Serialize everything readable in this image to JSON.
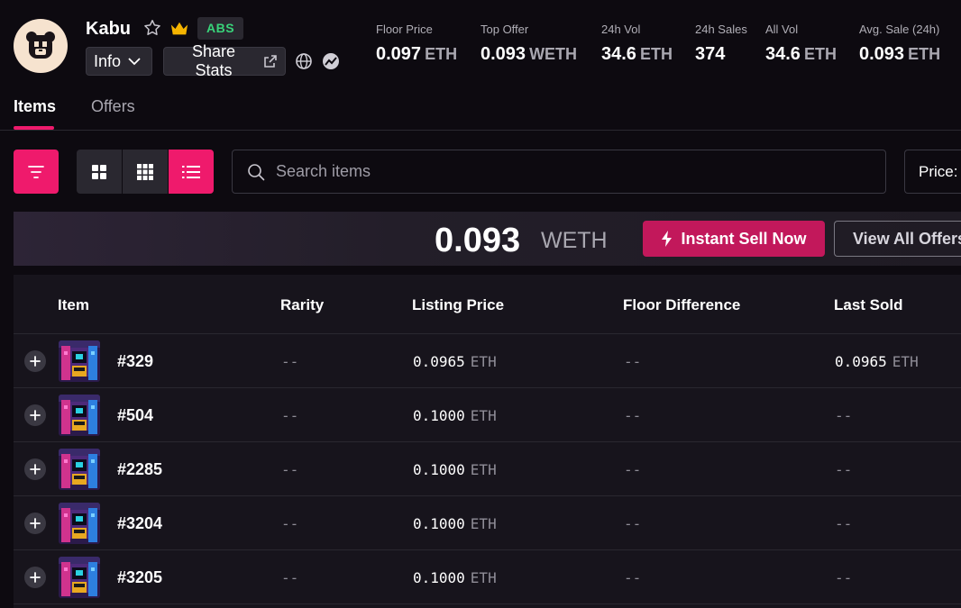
{
  "collection": {
    "name": "Kabu",
    "chain_badge": "ABS",
    "info_label": "Info",
    "share_label": "Share Stats"
  },
  "stats": [
    {
      "label": "Floor Price",
      "value": "0.097",
      "unit": "ETH"
    },
    {
      "label": "Top Offer",
      "value": "0.093",
      "unit": "WETH"
    },
    {
      "label": "24h Vol",
      "value": "34.6",
      "unit": "ETH"
    },
    {
      "label": "24h Sales",
      "value": "374",
      "unit": ""
    },
    {
      "label": "All Vol",
      "value": "34.6",
      "unit": "ETH"
    },
    {
      "label": "Avg. Sale (24h)",
      "value": "0.093",
      "unit": "ETH"
    }
  ],
  "tabs": [
    {
      "label": "Items",
      "active": true
    },
    {
      "label": "Offers",
      "active": false
    }
  ],
  "search": {
    "placeholder": "Search items"
  },
  "sort": {
    "label": "Price:"
  },
  "offer_banner": {
    "value": "0.093",
    "unit": "WETH",
    "sell_label": "Instant Sell Now",
    "view_label": "View All Offers"
  },
  "table": {
    "columns": [
      "Item",
      "Rarity",
      "Listing Price",
      "Floor Difference",
      "Last Sold"
    ],
    "rows": [
      {
        "name": "#329",
        "rarity": "--",
        "price": "0.0965",
        "price_unit": "ETH",
        "floor_diff": "--",
        "last_sold": "0.0965",
        "last_sold_unit": "ETH"
      },
      {
        "name": "#504",
        "rarity": "--",
        "price": "0.1000",
        "price_unit": "ETH",
        "floor_diff": "--",
        "last_sold": "--",
        "last_sold_unit": ""
      },
      {
        "name": "#2285",
        "rarity": "--",
        "price": "0.1000",
        "price_unit": "ETH",
        "floor_diff": "--",
        "last_sold": "--",
        "last_sold_unit": ""
      },
      {
        "name": "#3204",
        "rarity": "--",
        "price": "0.1000",
        "price_unit": "ETH",
        "floor_diff": "--",
        "last_sold": "--",
        "last_sold_unit": ""
      },
      {
        "name": "#3205",
        "rarity": "--",
        "price": "0.1000",
        "price_unit": "ETH",
        "floor_diff": "--",
        "last_sold": "--",
        "last_sold_unit": ""
      }
    ]
  },
  "colors": {
    "accent": "#ef1a6c",
    "sell_button": "#c2185b",
    "badge_green": "#39d37a",
    "background": "#0d0a10",
    "table_bg": "#17141c"
  },
  "icons": [
    "bear-logo-icon",
    "star-icon",
    "crown-icon",
    "chevron-down-icon",
    "external-link-icon",
    "globe-icon",
    "chart-icon",
    "filter-icon",
    "grid-large-icon",
    "grid-small-icon",
    "list-icon",
    "search-icon",
    "lightning-icon",
    "plus-icon"
  ]
}
